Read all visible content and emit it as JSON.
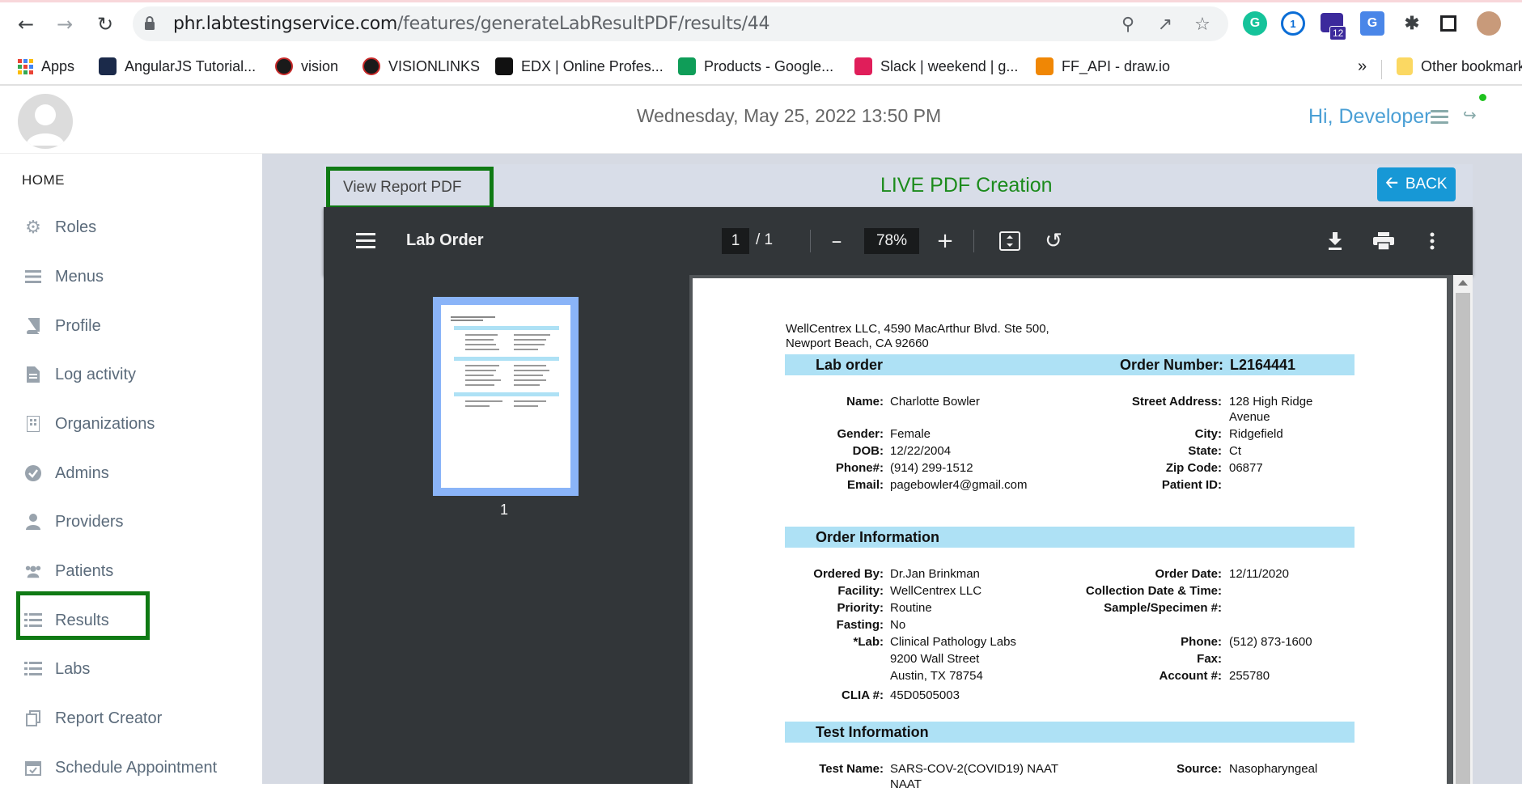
{
  "browser": {
    "url_host": "phr.labtestingservice.com",
    "url_path": "/features/generateLabResultPDF/results/44",
    "extension_badge": "12",
    "bookmarks": [
      {
        "label": "Apps",
        "color": "#e04040"
      },
      {
        "label": "AngularJS Tutorial...",
        "color": "#1b2a4a"
      },
      {
        "label": "vision",
        "color": "#1a1a1a"
      },
      {
        "label": "VISIONLINKS",
        "color": "#1a1a1a"
      },
      {
        "label": "EDX | Online Profes...",
        "color": "#111111"
      },
      {
        "label": "Products - Google...",
        "color": "#0f9d58"
      },
      {
        "label": "Slack | weekend | g...",
        "color": "#e01e5a"
      },
      {
        "label": "FF_API - draw.io",
        "color": "#f08705"
      }
    ],
    "more_bookmarks": "»",
    "other_bookmarks": "Other bookmarks"
  },
  "header": {
    "datetime": "Wednesday, May 25, 2022 13:50 PM",
    "greeting": "Hi, Developer"
  },
  "sidebar": {
    "home": "HOME",
    "items": [
      {
        "label": "Roles",
        "icon": "gear-icon"
      },
      {
        "label": "Menus",
        "icon": "bars-icon"
      },
      {
        "label": "Profile",
        "icon": "book-icon"
      },
      {
        "label": "Log activity",
        "icon": "file-icon"
      },
      {
        "label": "Organizations",
        "icon": "building-icon"
      },
      {
        "label": "Admins",
        "icon": "check-circle-icon"
      },
      {
        "label": "Providers",
        "icon": "user-doctor-icon"
      },
      {
        "label": "Patients",
        "icon": "users-icon"
      },
      {
        "label": "Results",
        "icon": "list-icon"
      },
      {
        "label": "Labs",
        "icon": "list-icon"
      },
      {
        "label": "Report Creator",
        "icon": "copy-icon"
      },
      {
        "label": "Schedule Appointment",
        "icon": "calendar-icon"
      }
    ]
  },
  "panel": {
    "view_report": "View Report PDF",
    "title": "LIVE PDF Creation",
    "back": "BACK"
  },
  "pdf_viewer": {
    "doc_title": "Lab Order",
    "page_current": "1",
    "page_total": "/ 1",
    "zoom": "78%",
    "thumb_page_number": "1"
  },
  "lab_order": {
    "address_line1": "WellCentrex LLC, 4590 MacArthur Blvd. Ste 500,",
    "address_line2": "Newport Beach, CA 92660",
    "section_lab_order": "Lab order",
    "order_number_label": "Order Number:",
    "order_number": "L2164441",
    "patient": {
      "name_label": "Name:",
      "name": "Charlotte Bowler",
      "gender_label": "Gender:",
      "gender": "Female",
      "dob_label": "DOB:",
      "dob": "12/22/2004",
      "phone_label": "Phone#:",
      "phone": "(914) 299-1512",
      "email_label": "Email:",
      "email": "pagebowler4@gmail.com",
      "street_label": "Street Address:",
      "street_line1": "128 High Ridge",
      "street_line2": "Avenue",
      "city_label": "City:",
      "city": "Ridgefield",
      "state_label": "State:",
      "state": "Ct",
      "zip_label": "Zip Code:",
      "zip": "06877",
      "patient_id_label": "Patient ID:",
      "patient_id": ""
    },
    "section_order_info": "Order Information",
    "order": {
      "ordered_by_label": "Ordered By:",
      "ordered_by": "Dr.Jan Brinkman",
      "facility_label": "Facility:",
      "facility": "WellCentrex LLC",
      "priority_label": "Priority:",
      "priority": "Routine",
      "fasting_label": "Fasting:",
      "fasting": "No",
      "lab_label": "*Lab:",
      "lab_line1": "Clinical Pathology Labs",
      "lab_line2": "9200 Wall Street",
      "lab_line3": "Austin, TX 78754",
      "clia_label": "CLIA #:",
      "clia": "45D0505003",
      "order_date_label": "Order Date:",
      "order_date": "12/11/2020",
      "collection_label": "Collection Date & Time:",
      "collection": "",
      "specimen_label": "Sample/Specimen #:",
      "specimen": "",
      "lab_phone_label": "Phone:",
      "lab_phone": "(512) 873-1600",
      "fax_label": "Fax:",
      "fax": "",
      "account_label": "Account #:",
      "account": "255780"
    },
    "section_test_info": "Test Information",
    "test": {
      "test_name_label": "Test Name:",
      "test_name_line1": "SARS-COV-2(COVID19) NAAT",
      "test_name_line2": "NAAT",
      "source_label": "Source:",
      "source": "Nasopharyngeal"
    }
  }
}
